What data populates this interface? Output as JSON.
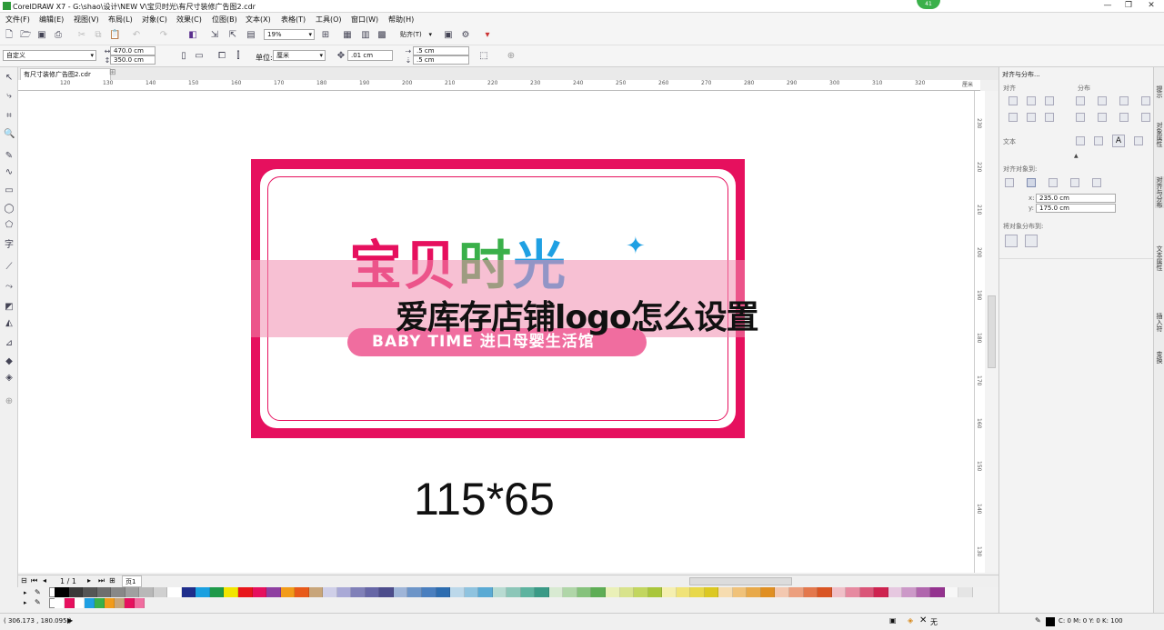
{
  "app": {
    "title": "CorelDRAW X7 - G:\\shao\\设计\\NEW V\\宝贝时光\\有尺寸装修广告图2.cdr",
    "badge": "41"
  },
  "menu": [
    "文件(F)",
    "编辑(E)",
    "视图(V)",
    "布局(L)",
    "对象(C)",
    "效果(C)",
    "位图(B)",
    "文本(X)",
    "表格(T)",
    "工具(O)",
    "窗口(W)",
    "帮助(H)"
  ],
  "toolbar1": {
    "zoom": "19%",
    "snap": "贴齐(T)"
  },
  "toolbar2": {
    "preset": "自定义",
    "width": "470.0 cm",
    "height": "350.0 cm",
    "unit_label": "单位:",
    "unit": "厘米",
    "nudge": ".01 cm",
    "dup_x": ".5 cm",
    "dup_y": ".5 cm"
  },
  "document": {
    "tab": "有尺寸装修广告图2.cdr"
  },
  "ruler": {
    "h_ticks": [
      "120",
      "130",
      "140",
      "150",
      "160",
      "170",
      "180",
      "190",
      "200",
      "210",
      "220",
      "230",
      "240",
      "250",
      "260",
      "270",
      "280",
      "290",
      "300",
      "310",
      "320"
    ],
    "h_unit": "厘米",
    "v_ticks": [
      "230",
      "220",
      "210",
      "200",
      "190",
      "180",
      "170",
      "160",
      "150",
      "140",
      "130"
    ]
  },
  "canvas": {
    "logo_chars": [
      "宝",
      "贝",
      "时",
      "光"
    ],
    "logo_colors": [
      "#e6105e",
      "#e6105e",
      "#3ab04a",
      "#1fa0e3"
    ],
    "slogan": "BABY TIME  进口母婴生活馆",
    "overlay": "爱库存店铺logo怎么设置",
    "size_text": "115*65"
  },
  "pagebar": {
    "page_count": "1 / 1",
    "page_name": "页1"
  },
  "palette": {
    "row1": [
      "#000000",
      "#3a3a3a",
      "#555555",
      "#6e6e6e",
      "#888888",
      "#a0a0a0",
      "#b8b8b8",
      "#d0d0d0",
      "#ffffff",
      "#1f2e8c",
      "#1aa0e0",
      "#1e9a4a",
      "#f2e500",
      "#e8161b",
      "#e6105e",
      "#8e3fa0",
      "#f29b1a",
      "#e85a1a",
      "#c8a57a",
      "#cfcfe8",
      "#a9a9d6",
      "#8080b8",
      "#6666a6",
      "#4d4d8c",
      "#9fb5d8",
      "#6d95c8",
      "#4a7fbf",
      "#2d6db0",
      "#bcd8ea",
      "#8fc3df",
      "#5aaad4",
      "#b8dbd2",
      "#8cc6b8",
      "#5db39f",
      "#3a9a86",
      "#d8ead2",
      "#b0d6a8",
      "#86c27c",
      "#5ead55",
      "#eaf0b8",
      "#d8e38c",
      "#c2d65f",
      "#a9c63b",
      "#f5efb0",
      "#f0e378",
      "#e8d84a",
      "#dcc822",
      "#f6dcb0",
      "#f0c27a",
      "#e8a94a",
      "#e08f22",
      "#f3c8b0",
      "#ec9f7e",
      "#e3784d",
      "#d95524",
      "#f0c0c8",
      "#e68aa0",
      "#da5578",
      "#ce2350",
      "#e6c8e0",
      "#cc99c8",
      "#b066ad",
      "#94338f",
      "#f7f7f7",
      "#e5e5e5"
    ],
    "row2": [
      "#ffffff",
      "#e6105e",
      "#ffffff",
      "#1fa0e3",
      "#3ab04a",
      "#f29b1a",
      "#c8a57a",
      "#e6105e",
      "#f06d9f"
    ]
  },
  "status": {
    "coords": "( 306.173 , 180.095 )",
    "fill_label": "无",
    "color_info": "C: 0 M: 0 Y: 0 K: 100"
  },
  "panel": {
    "title": "对齐与分布...",
    "align_label": "对齐",
    "distribute_label": "分布",
    "text_label": "文本",
    "align_to_label": "对齐对象到:",
    "x_label": "x:",
    "x_value": "235.0 cm",
    "y_label": "y:",
    "y_value": "175.0 cm",
    "distribute_to_label": "将对象分布到:"
  },
  "side_tabs": [
    "提示",
    "对象属性",
    "对齐与分布",
    "文本属性",
    "插入符",
    "变换"
  ]
}
